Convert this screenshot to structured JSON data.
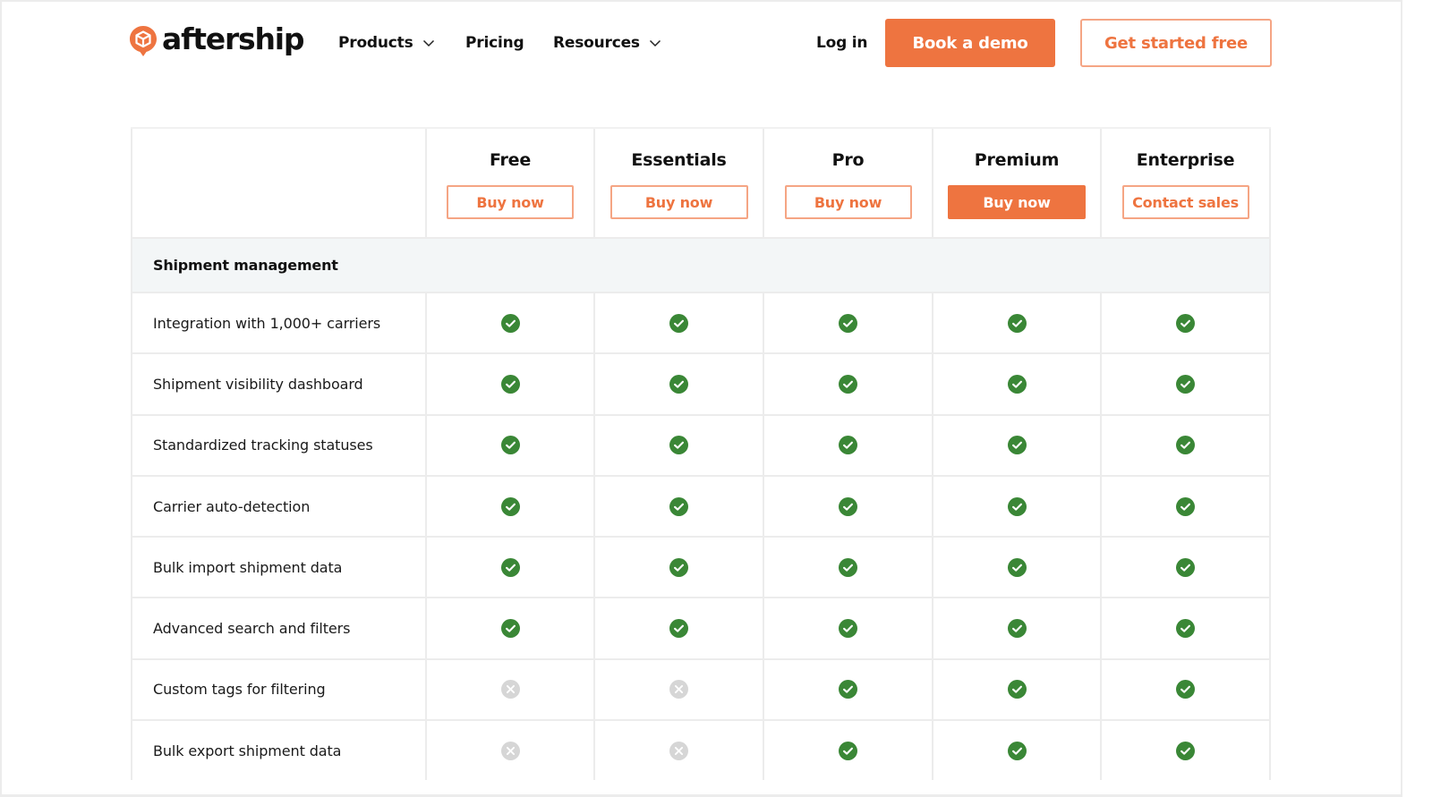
{
  "brand": {
    "name": "aftership",
    "accent_color": "#ee7440",
    "check_color": "#3a8736",
    "cross_color": "#d6d6d6"
  },
  "nav": {
    "links": [
      {
        "label": "Products",
        "has_dropdown": true
      },
      {
        "label": "Pricing",
        "has_dropdown": false
      },
      {
        "label": "Resources",
        "has_dropdown": true
      }
    ],
    "login_label": "Log in",
    "demo_label": "Book a demo",
    "start_label": "Get started free"
  },
  "plans": [
    {
      "name": "Free",
      "cta": "Buy now",
      "primary": false
    },
    {
      "name": "Essentials",
      "cta": "Buy now",
      "primary": false
    },
    {
      "name": "Pro",
      "cta": "Buy now",
      "primary": false
    },
    {
      "name": "Premium",
      "cta": "Buy now",
      "primary": true
    },
    {
      "name": "Enterprise",
      "cta": "Contact sales",
      "primary": false
    }
  ],
  "section": {
    "title": "Shipment management",
    "features": [
      {
        "name": "Integration with 1,000+ carriers",
        "availability": [
          true,
          true,
          true,
          true,
          true
        ]
      },
      {
        "name": "Shipment visibility dashboard",
        "availability": [
          true,
          true,
          true,
          true,
          true
        ]
      },
      {
        "name": "Standardized tracking statuses",
        "availability": [
          true,
          true,
          true,
          true,
          true
        ]
      },
      {
        "name": "Carrier auto-detection",
        "availability": [
          true,
          true,
          true,
          true,
          true
        ]
      },
      {
        "name": "Bulk import shipment data",
        "availability": [
          true,
          true,
          true,
          true,
          true
        ]
      },
      {
        "name": "Advanced search and filters",
        "availability": [
          true,
          true,
          true,
          true,
          true
        ]
      },
      {
        "name": "Custom tags for filtering",
        "availability": [
          false,
          false,
          true,
          true,
          true
        ]
      },
      {
        "name": "Bulk export shipment data",
        "availability": [
          false,
          false,
          true,
          true,
          true
        ]
      }
    ]
  }
}
